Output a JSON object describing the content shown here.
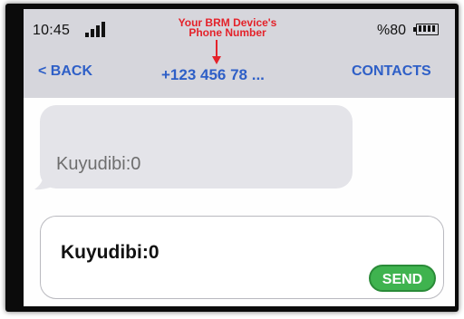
{
  "status_bar": {
    "time": "10:45",
    "battery_percent": "%80",
    "signal_icon": "signal-bars-icon",
    "battery_icon": "battery-icon"
  },
  "annotation": {
    "line1": "Your BRM Device's",
    "line2": "Phone Number",
    "arrow_icon": "down-arrow-icon"
  },
  "nav": {
    "back_label": "< BACK",
    "title": "+123 456 78 ...",
    "contacts_label": "CONTACTS"
  },
  "messages": [
    {
      "text": "Kuyudibi:0",
      "direction": "incoming"
    }
  ],
  "composer": {
    "value": "Kuyudibi:0",
    "send_label": "SEND"
  },
  "colors": {
    "accent_blue": "#2e5fc7",
    "annotation_red": "#e4222a",
    "send_green": "#3fb34f",
    "bubble_gray": "#e4e4e9",
    "header_gray": "#d6d6dc"
  }
}
